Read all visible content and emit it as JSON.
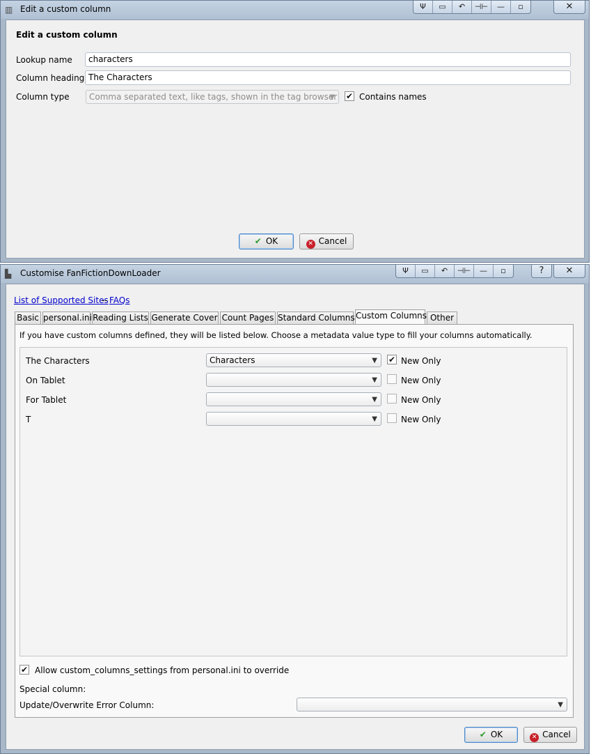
{
  "dialog1": {
    "title": "Edit a custom column",
    "heading": "Edit a custom column",
    "lookup_name_label": "Lookup name",
    "lookup_name_value": "characters",
    "column_heading_label": "Column heading",
    "column_heading_value": "The Characters",
    "column_type_label": "Column type",
    "column_type_value": "Comma separated text, like tags, shown in the tag browser",
    "contains_names_label": "Contains names",
    "contains_names_checked": true,
    "ok_label": "OK",
    "cancel_label": "Cancel"
  },
  "dialog2": {
    "title": "Customise FanFictionDownLoader",
    "link_sites": "List of Supported Sites",
    "link_separator": "--",
    "link_faqs": "FAQs",
    "tabs": [
      {
        "label": "Basic"
      },
      {
        "label": "personal.ini"
      },
      {
        "label": "Reading Lists"
      },
      {
        "label": "Generate Cover"
      },
      {
        "label": "Count Pages"
      },
      {
        "label": "Standard Columns"
      },
      {
        "label": "Custom Columns",
        "active": true
      },
      {
        "label": "Other"
      }
    ],
    "description": "If you have custom columns defined, they will be listed below.  Choose a metadata value type to fill your columns automatically.",
    "rows": [
      {
        "name": "The Characters",
        "value": "Characters",
        "new_only_label": "New Only",
        "new_only": true
      },
      {
        "name": "On Tablet",
        "value": "",
        "new_only_label": "New Only",
        "new_only": false
      },
      {
        "name": "For Tablet",
        "value": "",
        "new_only_label": "New Only",
        "new_only": false
      },
      {
        "name": "T",
        "value": "",
        "new_only_label": "New Only",
        "new_only": false
      }
    ],
    "allow_override_label": "Allow custom_columns_settings from personal.ini to override",
    "allow_override_checked": true,
    "special_column_label": "Special column:",
    "error_column_label": "Update/Overwrite Error Column:",
    "error_column_value": "",
    "ok_label": "OK",
    "cancel_label": "Cancel"
  },
  "titlebar_controls": {
    "buttons": [
      "Ψ",
      "▭",
      "↶",
      "⊣⊢",
      "—",
      "▫"
    ],
    "help": "?",
    "close": "✕"
  },
  "colors": {
    "frame": "#a9b8c9",
    "client": "#f0f0f0",
    "link": "#0000cc",
    "ok_check": "#2e9a2e",
    "cancel_red": "#c8202a"
  }
}
